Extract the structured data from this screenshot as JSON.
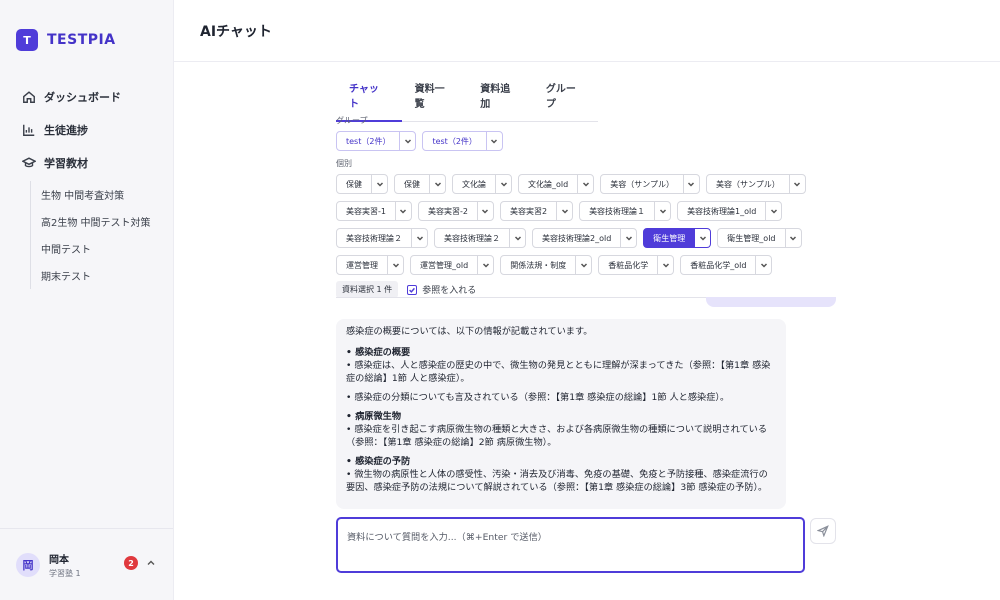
{
  "brand": {
    "logo_letter": "T",
    "name": "TESTPIA"
  },
  "sidebar": {
    "nav": [
      {
        "label": "ダッシュボード",
        "icon": "home-icon"
      },
      {
        "label": "生徒進捗",
        "icon": "chart-icon"
      },
      {
        "label": "学習教材",
        "icon": "graduation-cap-icon"
      }
    ],
    "subitems": [
      "生物 中間考査対策",
      "高2生物 中間テスト対策",
      "中間テスト",
      "期末テスト"
    ],
    "user": {
      "avatar_initial": "岡",
      "name": "岡本",
      "subtitle": "学習塾 1",
      "notification_count": "2"
    }
  },
  "header": {
    "title": "AIチャット"
  },
  "tabs": [
    {
      "label": "チャット",
      "active": true
    },
    {
      "label": "資料一覧",
      "active": false
    },
    {
      "label": "資料追加",
      "active": false
    },
    {
      "label": "グループ",
      "active": false
    }
  ],
  "filters": {
    "group_label": "グループ",
    "groups": [
      "test（2件）",
      "test（2件）"
    ],
    "individual_label": "個別",
    "rows": [
      [
        "保健",
        "保健",
        "文化論",
        "文化論_old",
        "美容（サンプル）",
        "美容（サンプル）"
      ],
      [
        "美容実習-1",
        "美容実習-2",
        "美容実習2",
        "美容技術理論１",
        "美容技術理論1_old"
      ],
      [
        "美容技術理論２",
        "美容技術理論２",
        "美容技術理論2_old",
        "衛生管理",
        "衛生管理_old"
      ],
      [
        "運営管理",
        "運営管理_old",
        "関係法規・制度",
        "香粧品化学",
        "香粧品化学_old"
      ]
    ],
    "selected_item": "衛生管理",
    "selection_count": "資料選択 1 件",
    "include_refs_label": "参照を入れる",
    "include_refs_checked": true
  },
  "answer": {
    "intro": "感染症の概要については、以下の情報が記載されています。",
    "sections": [
      {
        "heading": "• 感染症の概要",
        "lines": [
          "• 感染症は、人と感染症の歴史の中で、微生物の発見とともに理解が深まってきた（参照：【第1章 感染症の総論】1節 人と感染症）。"
        ]
      },
      {
        "heading": "",
        "lines": [
          "• 感染症の分類についても言及されている（参照：【第1章 感染症の総論】1節 人と感染症）。"
        ]
      },
      {
        "heading": "• 病原微生物",
        "lines": [
          "• 感染症を引き起こす病原微生物の種類と大きさ、および各病原微生物の種類について説明されている（参照：【第1章 感染症の総論】2節 病原微生物）。"
        ]
      },
      {
        "heading": "• 感染症の予防",
        "lines": [
          "• 微生物の病原性と人体の感受性、汚染・消去及び消毒、免疫の基礎、免疫と予防接種、感染症流行の要因、感染症予防の法規について解説されている（参照：【第1章 感染症の総論】3節 感染症の予防）。"
        ]
      }
    ]
  },
  "composer": {
    "placeholder": "資料について質問を入力...（⌘+Enter で送信）",
    "send_icon": "send-icon"
  },
  "colors": {
    "accent": "#4f3cd9",
    "badge": "#e0393e"
  }
}
